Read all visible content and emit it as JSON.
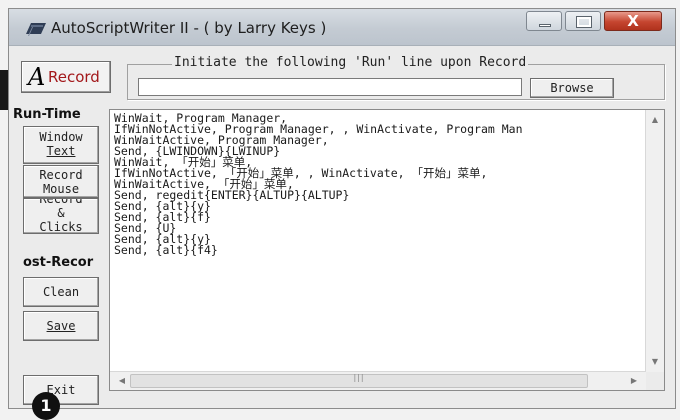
{
  "window": {
    "title": "AutoScriptWriter II - ( by Larry Keys )",
    "close_glyph": "X"
  },
  "toolbar": {
    "record_letter": "A",
    "record_label": "Record",
    "run_group_label": "Initiate the following 'Run' line upon Record",
    "run_input_value": "",
    "browse_label": "Browse"
  },
  "sidebar": {
    "run_time_label": "Run-Time",
    "window_text_lines": [
      "Window",
      "Text"
    ],
    "record_mouse_lines": [
      "Record",
      "Mouse"
    ],
    "record_clicks_lines": [
      "Record",
      "&",
      "Clicks"
    ],
    "post_record_label": "ost-Recor",
    "clean_label": "Clean",
    "save_label": "Save",
    "exit_label": "Exit"
  },
  "editor": {
    "lines": [
      "WinWait, Program Manager,",
      "IfWinNotActive, Program Manager, , WinActivate, Program Man",
      "WinWaitActive, Program Manager,",
      "Send, {LWINDOWN}{LWINUP}",
      "WinWait, 「开始」菜单,",
      "IfWinNotActive, 「开始」菜单, , WinActivate, 「开始」菜单,",
      "WinWaitActive, 「开始」菜单,",
      "Send, regedit{ENTER}{ALTUP}{ALTUP}",
      "Send, {alt}{y}",
      "Send, {alt}{f}",
      "Send, {U}",
      "Send, {alt}{y}",
      "Send, {alt}{f4}"
    ]
  },
  "badge_number": "1",
  "colors": {
    "record_label": "#a3181b",
    "close_button": "#c5452f"
  }
}
